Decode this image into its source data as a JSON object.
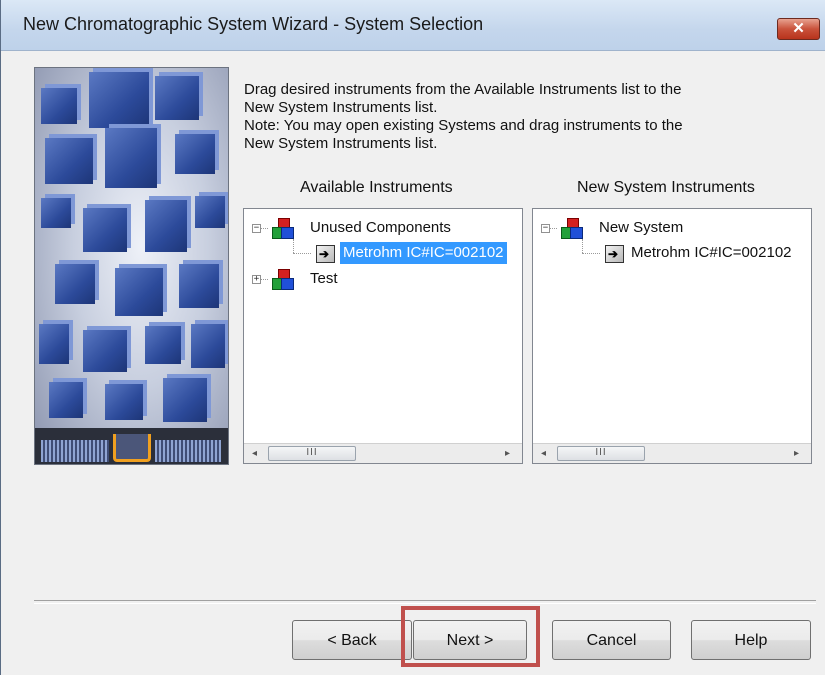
{
  "window": {
    "title": "New Chromatographic System Wizard - System Selection",
    "close_glyph": "✕"
  },
  "instructions": {
    "line1": "Drag desired instruments from the Available Instruments list to the",
    "line2": "New System Instruments list.",
    "line3": "Note:  You may open existing Systems and drag instruments to the",
    "line4": "New System Instruments list."
  },
  "available": {
    "header": "Available Instruments",
    "items": [
      {
        "label": "Unused Components",
        "icon": "system-icon",
        "expander": "−"
      },
      {
        "label": "Metrohm IC#IC=002102",
        "icon": "instrument-icon",
        "selected": true
      },
      {
        "label": "Test",
        "icon": "system-icon",
        "expander": "+"
      }
    ]
  },
  "new_system": {
    "header": "New System Instruments",
    "items": [
      {
        "label": "New System",
        "icon": "system-icon",
        "expander": "−"
      },
      {
        "label": "Metrohm IC#IC=002102",
        "icon": "instrument-icon"
      }
    ]
  },
  "scrollbar": {
    "left": "◂",
    "right": "▸",
    "thumb": "III"
  },
  "buttons": {
    "back": "< Back",
    "next": "Next >",
    "cancel": "Cancel",
    "help": "Help"
  },
  "colors": {
    "selection": "#3399ff",
    "highlight_box": "#c0504d",
    "close_button": "#c9523b"
  }
}
